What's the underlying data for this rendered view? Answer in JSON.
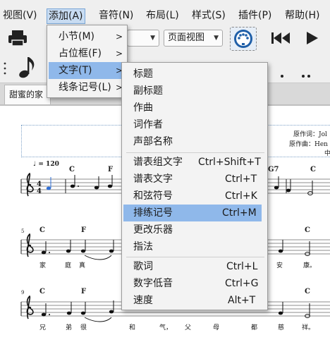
{
  "menubar": {
    "items": [
      {
        "label": "视图(V)"
      },
      {
        "label": "添加(A)"
      },
      {
        "label": "音符(N)"
      },
      {
        "label": "布局(L)"
      },
      {
        "label": "样式(S)"
      },
      {
        "label": "插件(P)"
      },
      {
        "label": "帮助(H)"
      }
    ]
  },
  "toolbar": {
    "view_mode": "页面视图",
    "print_icon": "printer-icon",
    "midi_icon": "midi-port-icon",
    "rewind_icon": "skip-back-icon",
    "play_icon": "play-icon"
  },
  "tabs": [
    {
      "label": "甜蜜的家"
    }
  ],
  "score": {
    "credits": [
      "原作词：Jol",
      "原作曲：Hen",
      "中"
    ],
    "tempo": "♩ = 120",
    "chords_row1": [
      "C",
      "F",
      "G7",
      "C"
    ],
    "chords_row2": [
      "C",
      "F",
      "C"
    ],
    "chords_row3": [
      "C",
      "F",
      "C"
    ],
    "system_numbers": [
      "5",
      "9"
    ],
    "lyrics_row2": [
      "家",
      "庭",
      "真",
      "安",
      "康。"
    ],
    "lyrics_row3": [
      "兄",
      "弟",
      "很",
      "和",
      "气，",
      "父",
      "母",
      "都",
      "慈",
      "祥。"
    ]
  },
  "add_menu": {
    "items": [
      {
        "label": "小节(M)",
        "submenu": true
      },
      {
        "label": "占位框(F)",
        "submenu": true
      },
      {
        "label": "文字(T)",
        "submenu": true,
        "highlighted": true
      },
      {
        "label": "线条记号(L)",
        "submenu": true
      }
    ]
  },
  "text_submenu": {
    "items": [
      {
        "label": "标题",
        "shortcut": ""
      },
      {
        "label": "副标题",
        "shortcut": ""
      },
      {
        "label": "作曲",
        "shortcut": ""
      },
      {
        "label": "词作者",
        "shortcut": ""
      },
      {
        "label": "声部名称",
        "shortcut": ""
      },
      {
        "label": "谱表组文字",
        "shortcut": "Ctrl+Shift+T"
      },
      {
        "label": "谱表文字",
        "shortcut": "Ctrl+T"
      },
      {
        "label": "和弦符号",
        "shortcut": "Ctrl+K"
      },
      {
        "label": "排练记号",
        "shortcut": "Ctrl+M",
        "highlighted": true
      },
      {
        "label": "更改乐器",
        "shortcut": ""
      },
      {
        "label": "指法",
        "shortcut": ""
      },
      {
        "label": "歌词",
        "shortcut": "Ctrl+L"
      },
      {
        "label": "数字低音",
        "shortcut": "Ctrl+G"
      },
      {
        "label": "速度",
        "shortcut": "Alt+T"
      }
    ]
  },
  "colors": {
    "highlight": "#8fb8ea",
    "menubar_active": "#c8dcf2",
    "selected_note": "#2f6fd6"
  }
}
